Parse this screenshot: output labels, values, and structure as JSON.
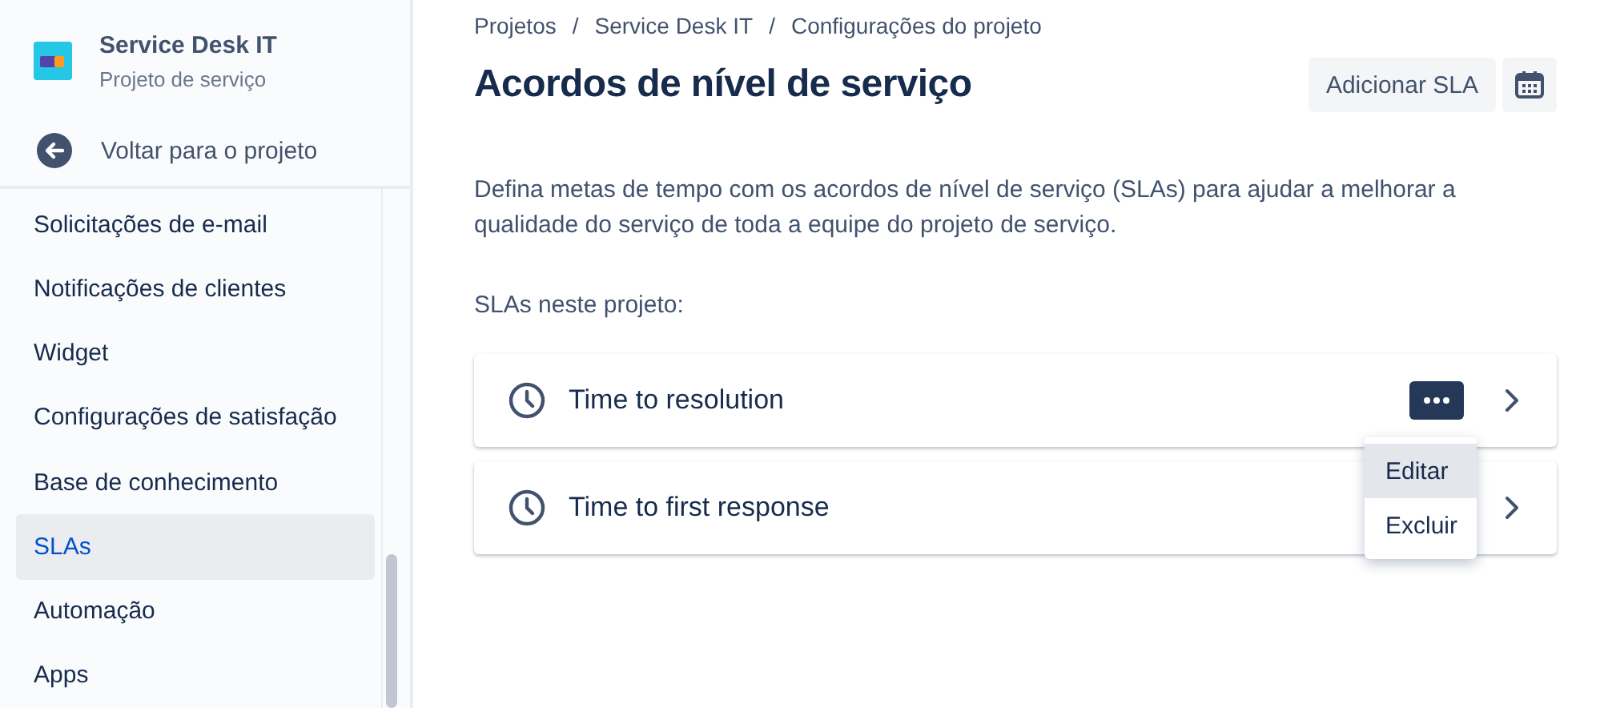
{
  "project": {
    "name": "Service Desk IT",
    "type": "Projeto de serviço"
  },
  "back_link": "Voltar para o projeto",
  "sidebar": {
    "items": [
      {
        "label": "Solicitações de e-mail",
        "selected": false
      },
      {
        "label": "Notificações de clientes",
        "selected": false
      },
      {
        "label": "Widget",
        "selected": false
      },
      {
        "label": "Configurações de satisfação",
        "selected": false
      },
      {
        "label": "Base de conhecimento",
        "selected": false
      },
      {
        "label": "SLAs",
        "selected": true
      },
      {
        "label": "Automação",
        "selected": false
      },
      {
        "label": "Apps",
        "selected": false
      }
    ]
  },
  "breadcrumbs": [
    "Projetos",
    "Service Desk IT",
    "Configurações do projeto"
  ],
  "breadcrumb_separators": [
    "/",
    "/"
  ],
  "title": "Acordos de nível de serviço",
  "add_button": "Adicionar SLA",
  "description": "Defina metas de tempo com os acordos de nível de serviço (SLAs) para ajudar a melhorar a qualidade do serviço de toda a equipe do projeto de serviço.",
  "list_label": "SLAs neste projeto:",
  "slas": [
    {
      "name": "Time to resolution",
      "menu_open": true
    },
    {
      "name": "Time to first response",
      "menu_open": false
    }
  ],
  "menu": {
    "items": [
      {
        "label": "Editar",
        "selected": true
      },
      {
        "label": "Excluir",
        "selected": false
      }
    ]
  }
}
